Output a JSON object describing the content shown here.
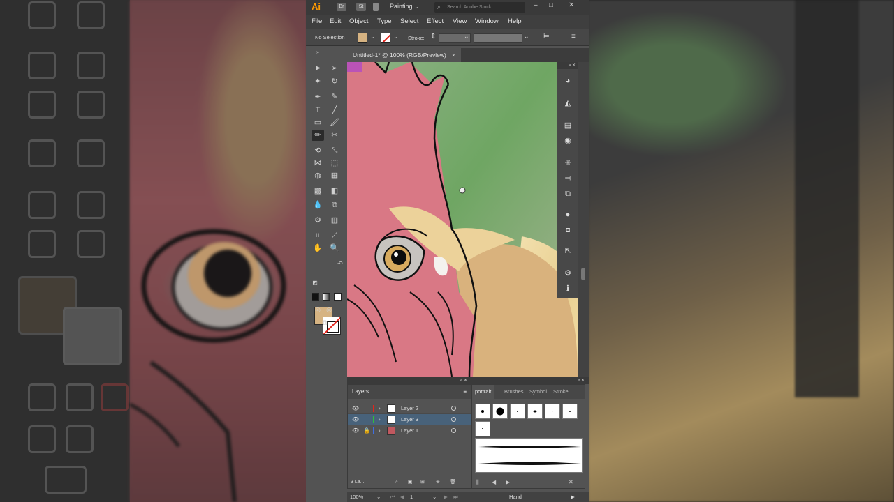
{
  "app": {
    "logo": "Ai",
    "bridge_btn": "Br",
    "stock_btn": "St",
    "workspace": "Painting",
    "search_placeholder": "Search Adobe Stock"
  },
  "menu": [
    "File",
    "Edit",
    "Object",
    "Type",
    "Select",
    "Effect",
    "View",
    "Window",
    "Help"
  ],
  "control_bar": {
    "selection_status": "No Selection",
    "stroke_label": "Stroke:",
    "fill_color": "#d6b382"
  },
  "document_tab": {
    "title": "Untitled-1* @ 100% (RGB/Preview)",
    "close": "×"
  },
  "layers_panel": {
    "title": "Layers",
    "layers": [
      {
        "name": "Layer 2",
        "color": "#e2231a",
        "selected": false
      },
      {
        "name": "Layer 3",
        "color": "#2fbf3a",
        "selected": true
      },
      {
        "name": "Layer 1",
        "color": "#3f6fe0",
        "selected": false
      }
    ],
    "footer_count": "3 La..."
  },
  "brush_panel": {
    "tabs": [
      "portrait",
      "Brushes",
      "Symbol",
      "Stroke"
    ],
    "active_tab": "portrait"
  },
  "status_bar": {
    "zoom": "100%",
    "artboard": "1",
    "tool": "Hand"
  }
}
